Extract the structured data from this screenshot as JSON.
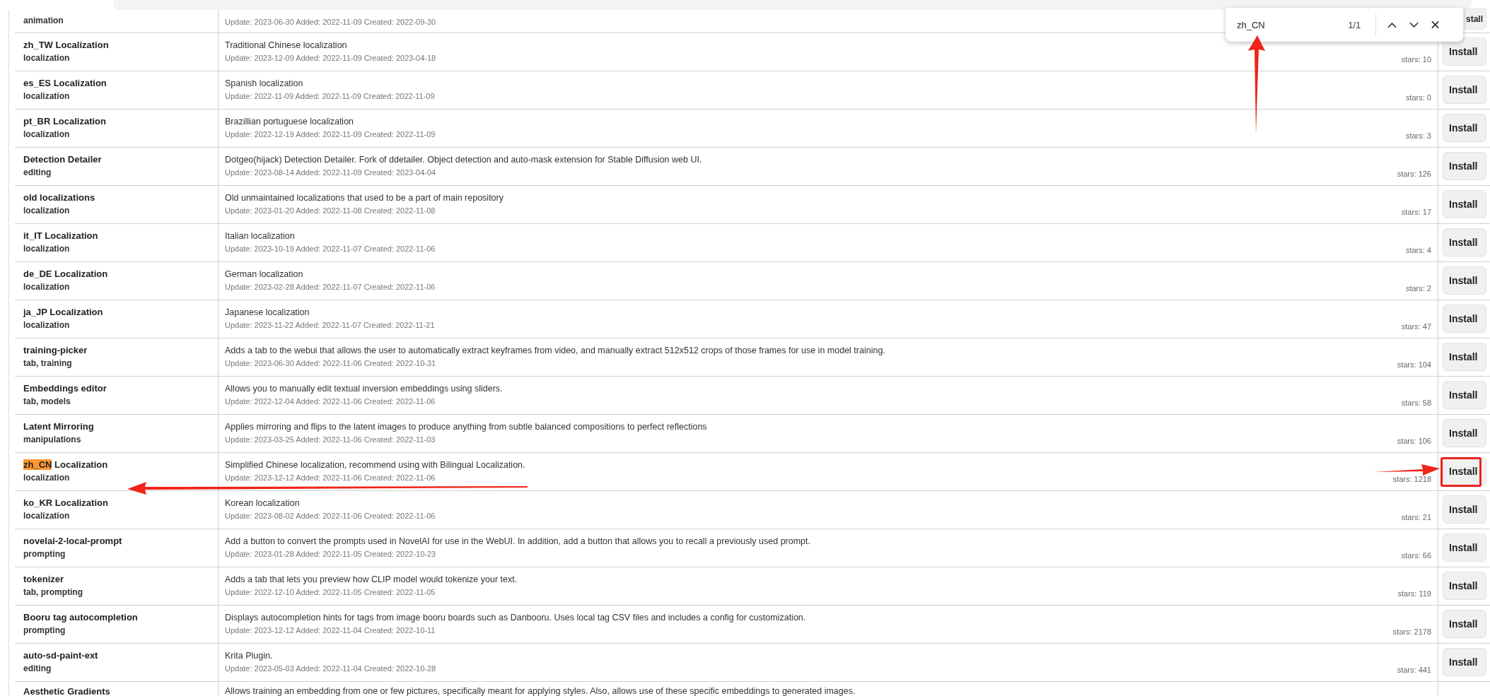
{
  "find_bar": {
    "query": "zh_CN",
    "count": "1/1"
  },
  "rows": [
    {
      "category": "animation",
      "dates": "Update: 2023-06-30 Added: 2022-11-09 Created: 2022-09-30",
      "button": "stall"
    },
    {
      "name": "zh_TW Localization",
      "category": "localization",
      "description": "Traditional Chinese localization",
      "dates": "Update: 2023-12-09 Added: 2022-11-09 Created: 2023-04-18",
      "stars": "stars: 10",
      "button": "Install"
    },
    {
      "name": "es_ES Localization",
      "category": "localization",
      "description": "Spanish localization",
      "dates": "Update: 2022-11-09 Added: 2022-11-09 Created: 2022-11-09",
      "stars": "stars: 0",
      "button": "Install"
    },
    {
      "name": "pt_BR Localization",
      "category": "localization",
      "description": "Brazillian portuguese localization",
      "dates": "Update: 2022-12-19 Added: 2022-11-09 Created: 2022-11-09",
      "stars": "stars: 3",
      "button": "Install"
    },
    {
      "name": "Detection Detailer",
      "category": "editing",
      "description": "Dotgeo(hijack) Detection Detailer. Fork of ddetailer. Object detection and auto-mask extension for Stable Diffusion web UI.",
      "dates": "Update: 2023-08-14 Added: 2022-11-09 Created: 2023-04-04",
      "stars": "stars: 126",
      "button": "Install"
    },
    {
      "name": "old localizations",
      "category": "localization",
      "description": "Old unmaintained localizations that used to be a part of main repository",
      "dates": "Update: 2023-01-20 Added: 2022-11-08 Created: 2022-11-08",
      "stars": "stars: 17",
      "button": "Install"
    },
    {
      "name": "it_IT Localization",
      "category": "localization",
      "description": "Italian localization",
      "dates": "Update: 2023-10-19 Added: 2022-11-07 Created: 2022-11-06",
      "stars": "stars: 4",
      "button": "Install"
    },
    {
      "name": "de_DE Localization",
      "category": "localization",
      "description": "German localization",
      "dates": "Update: 2023-02-28 Added: 2022-11-07 Created: 2022-11-06",
      "stars": "stars: 2",
      "button": "Install"
    },
    {
      "name": "ja_JP Localization",
      "category": "localization",
      "description": "Japanese localization",
      "dates": "Update: 2023-11-22 Added: 2022-11-07 Created: 2022-11-21",
      "stars": "stars: 47",
      "button": "Install"
    },
    {
      "name": "training-picker",
      "category": "tab, training",
      "description": "Adds a tab to the webui that allows the user to automatically extract keyframes from video, and manually extract 512x512 crops of those frames for use in model training.",
      "dates": "Update: 2023-06-30 Added: 2022-11-06 Created: 2022-10-31",
      "stars": "stars: 104",
      "button": "Install"
    },
    {
      "name": "Embeddings editor",
      "category": "tab, models",
      "description": "Allows you to manually edit textual inversion embeddings using sliders.",
      "dates": "Update: 2022-12-04 Added: 2022-11-06 Created: 2022-11-06",
      "stars": "stars: 58",
      "button": "Install"
    },
    {
      "name": "Latent Mirroring",
      "category": "manipulations",
      "description": "Applies mirroring and flips to the latent images to produce anything from subtle balanced compositions to perfect reflections",
      "dates": "Update: 2023-03-25 Added: 2022-11-06 Created: 2022-11-03",
      "stars": "stars: 106",
      "button": "Install"
    },
    {
      "name_match": "zh_CN",
      "name": "Localization",
      "category": "localization",
      "description": "Simplified Chinese localization, recommend using with Bilingual Localization.",
      "dates": "Update: 2023-12-12 Added: 2022-11-06 Created: 2022-11-06",
      "stars": "stars: 1218",
      "button": "Install",
      "marked": true
    },
    {
      "name": "ko_KR Localization",
      "category": "localization",
      "description": "Korean localization",
      "dates": "Update: 2023-08-02 Added: 2022-11-06 Created: 2022-11-06",
      "stars": "stars: 21",
      "button": "Install"
    },
    {
      "name": "novelai-2-local-prompt",
      "category": "prompting",
      "description": "Add a button to convert the prompts used in NovelAI for use in the WebUI. In addition, add a button that allows you to recall a previously used prompt.",
      "dates": "Update: 2023-01-28 Added: 2022-11-05 Created: 2022-10-23",
      "stars": "stars: 66",
      "button": "Install"
    },
    {
      "name": "tokenizer",
      "category": "tab, prompting",
      "description": "Adds a tab that lets you preview how CLIP model would tokenize your text.",
      "dates": "Update: 2022-12-10 Added: 2022-11-05 Created: 2022-11-05",
      "stars": "stars: 119",
      "button": "Install"
    },
    {
      "name": "Booru tag autocompletion",
      "category": "prompting",
      "description": "Displays autocompletion hints for tags from image booru boards such as Danbooru. Uses local tag CSV files and includes a config for customization.",
      "dates": "Update: 2023-12-12 Added: 2022-11-04 Created: 2022-10-11",
      "stars": "stars: 2178",
      "button": "Install"
    },
    {
      "name": "auto-sd-paint-ext",
      "category": "editing",
      "description": "Krita Plugin.",
      "dates": "Update: 2023-05-03 Added: 2022-11-04 Created: 2022-10-28",
      "stars": "stars: 441",
      "button": "Install"
    },
    {
      "name": "Aesthetic Gradients",
      "description": "Allows training an embedding from one or few pictures, specifically meant for applying styles. Also, allows use of these specific embeddings to generated images."
    }
  ]
}
